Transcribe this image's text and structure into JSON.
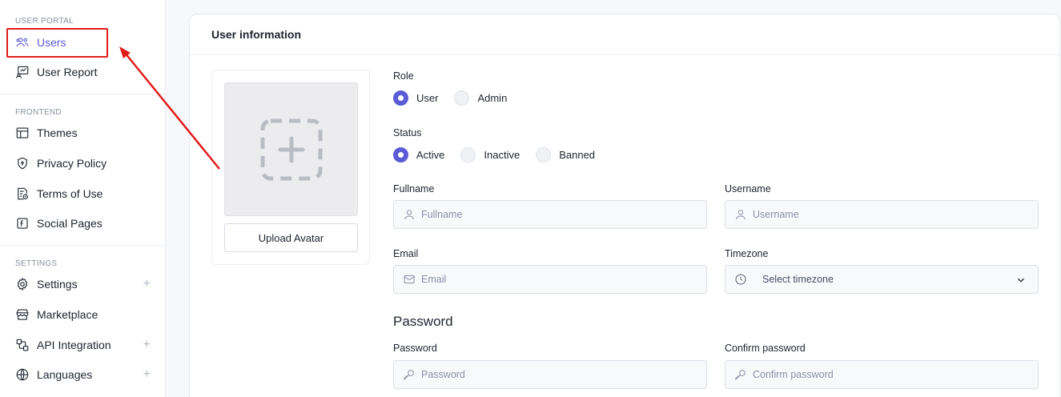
{
  "sidebar": {
    "sections": [
      {
        "label": "USER PORTAL"
      },
      {
        "label": "FRONTEND"
      },
      {
        "label": "SETTINGS"
      }
    ],
    "items": [
      {
        "label": "Users",
        "icon": "users-icon",
        "active": true
      },
      {
        "label": "User Report",
        "icon": "user-report-icon"
      },
      {
        "label": "Themes",
        "icon": "themes-icon"
      },
      {
        "label": "Privacy Policy",
        "icon": "shield-icon"
      },
      {
        "label": "Terms of Use",
        "icon": "document-clock-icon"
      },
      {
        "label": "Social Pages",
        "icon": "social-icon"
      },
      {
        "label": "Settings",
        "icon": "gear-icon",
        "expandable": true
      },
      {
        "label": "Marketplace",
        "icon": "store-icon"
      },
      {
        "label": "API Integration",
        "icon": "api-icon",
        "expandable": true
      },
      {
        "label": "Languages",
        "icon": "globe-icon",
        "expandable": true
      }
    ],
    "expand_symbol": "+"
  },
  "main": {
    "title": "User information",
    "upload_label": "Upload Avatar",
    "role": {
      "label": "Role",
      "options": [
        "User",
        "Admin"
      ],
      "selected": "User"
    },
    "status": {
      "label": "Status",
      "options": [
        "Active",
        "Inactive",
        "Banned"
      ],
      "selected": "Active"
    },
    "fullname": {
      "label": "Fullname",
      "placeholder": "Fullname"
    },
    "username": {
      "label": "Username",
      "placeholder": "Username"
    },
    "email": {
      "label": "Email",
      "placeholder": "Email"
    },
    "timezone": {
      "label": "Timezone",
      "placeholder": "Select timezone"
    },
    "password_section": "Password",
    "password": {
      "label": "Password",
      "placeholder": "Password"
    },
    "confirm_password": {
      "label": "Confirm password",
      "placeholder": "Confirm password"
    }
  },
  "colors": {
    "accent": "#5b5bd6",
    "annotation": "#e21b1b"
  }
}
